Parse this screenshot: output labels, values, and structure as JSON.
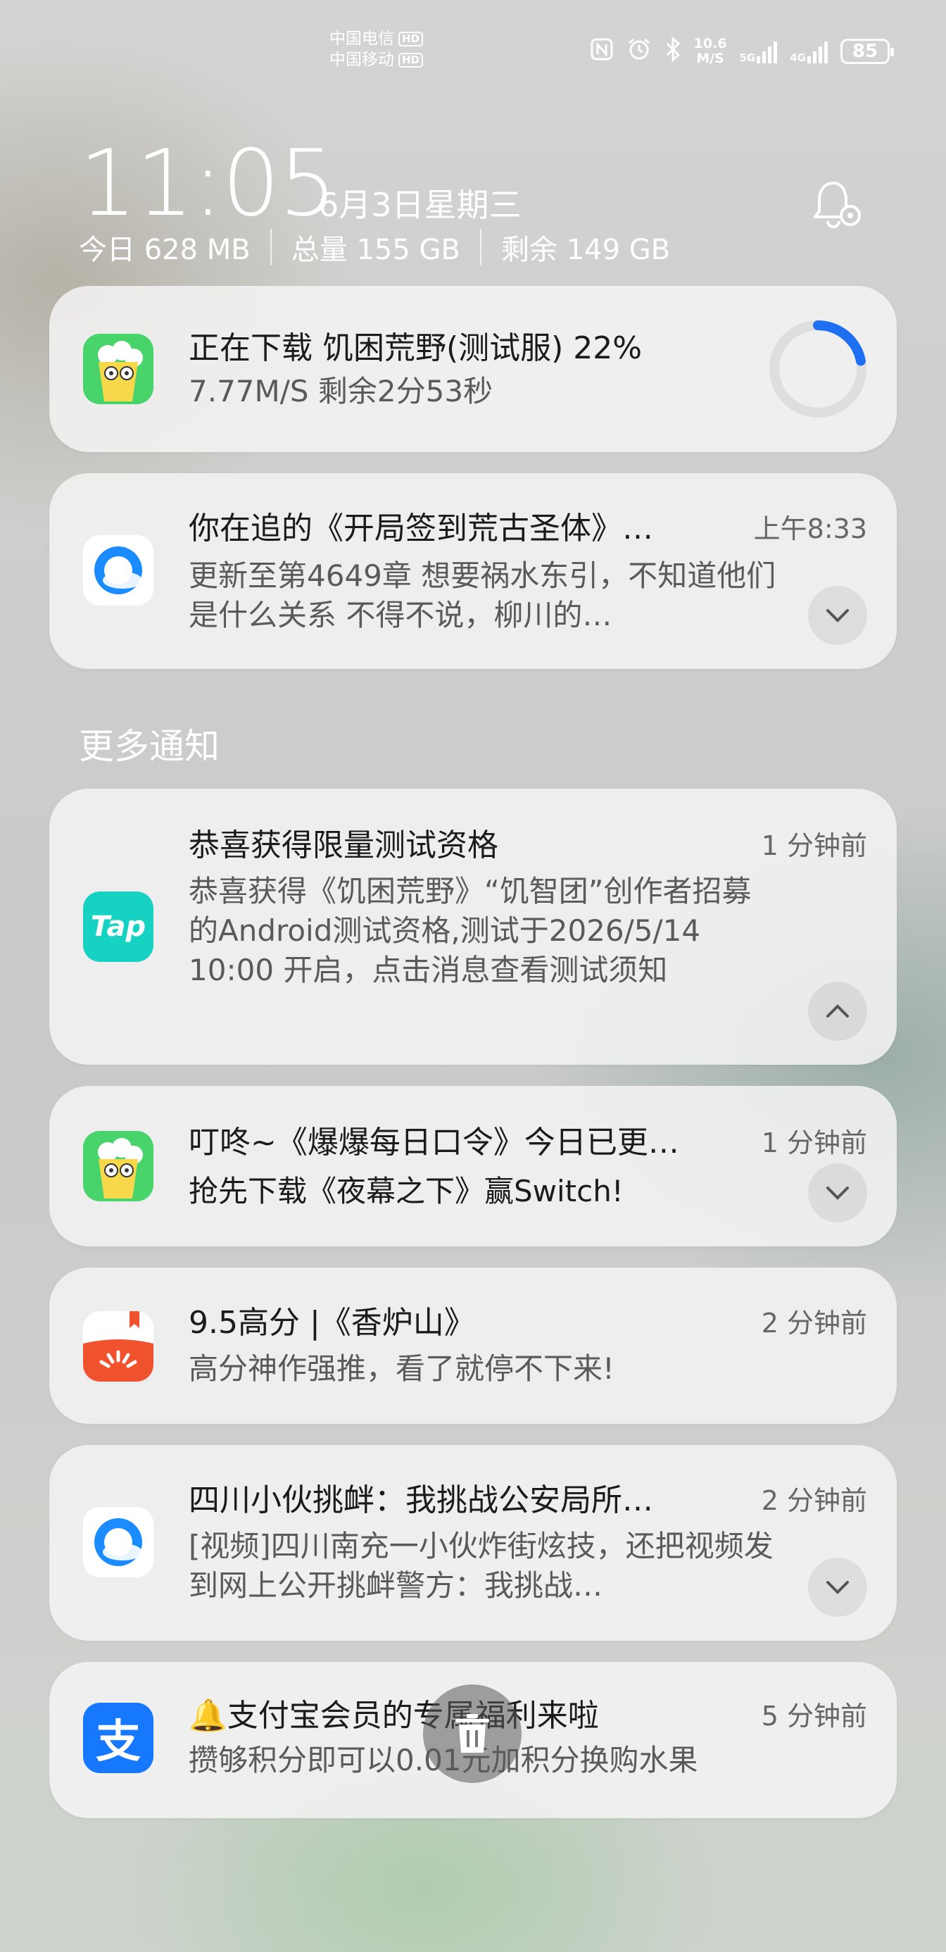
{
  "status_bar": {
    "carrier1": "中国电信",
    "carrier2": "中国移动",
    "hd_label": "HD",
    "net_speed_value": "10.6",
    "net_speed_unit": "M/S",
    "net1_type": "5G",
    "net2_type": "4G",
    "battery_level": "85",
    "icons": [
      "nfc-icon",
      "alarm-icon",
      "bluetooth-icon"
    ]
  },
  "lock_info": {
    "time": "11:05",
    "date": "6月3日星期三",
    "storage": {
      "today": "今日 628 MB",
      "total": "总量 155 GB",
      "free": "剩余 149 GB"
    }
  },
  "notifications": [
    {
      "app_icon": "game-popcorn-icon",
      "title": "正在下载  饥困荒野(测试服) 22%",
      "body": "7.77M/S  剩余2分53秒",
      "progress": 0.22
    },
    {
      "app_icon": "qq-browser-icon",
      "title": "你在追的《开局签到荒古圣体》…",
      "time": "上午8:33",
      "body": "更新至第4649章 想要祸水东引，不知道他们是什么关系 不得不说，柳川的…"
    }
  ],
  "more_section_title": "更多通知",
  "more_notifications": [
    {
      "app_icon": "taptap-icon",
      "app_icon_text": "Tap",
      "title": "恭喜获得限量测试资格",
      "time": "1 分钟前",
      "body": "恭喜获得《饥困荒野》“饥智团”创作者招募的Android测试资格,测试于2026/5/14 10:00 开启，点击消息查看测试须知"
    },
    {
      "app_icon": "game-popcorn-icon",
      "title": "叮咚~《爆爆每日口令》今日已更…",
      "time": "1 分钟前",
      "body": "抢先下载《夜幕之下》赢Switch!"
    },
    {
      "app_icon": "tomato-novel-icon",
      "title": "9.5高分 |《香炉山》",
      "time": "2 分钟前",
      "body": "高分神作强推，看了就停不下来!"
    },
    {
      "app_icon": "qq-browser-icon",
      "title": "四川小伙挑衅：我挑战公安局所…",
      "time": "2 分钟前",
      "body": "[视频]四川南充一小伙炸街炫技，还把视频发到网上公开挑衅警方：我挑战…"
    },
    {
      "app_icon": "alipay-icon",
      "app_icon_text": "支",
      "title": "🔔支付宝会员的专属福利来啦",
      "time": "5 分钟前",
      "body": "攒够积分即可以0.01元加积分换购水果"
    }
  ],
  "colors": {
    "progress_accent": "#1f6ff2",
    "taptap": "#16d2c2",
    "alipay": "#1677ff",
    "tomato": "#f0522e",
    "game_bg": "#48d46a"
  }
}
